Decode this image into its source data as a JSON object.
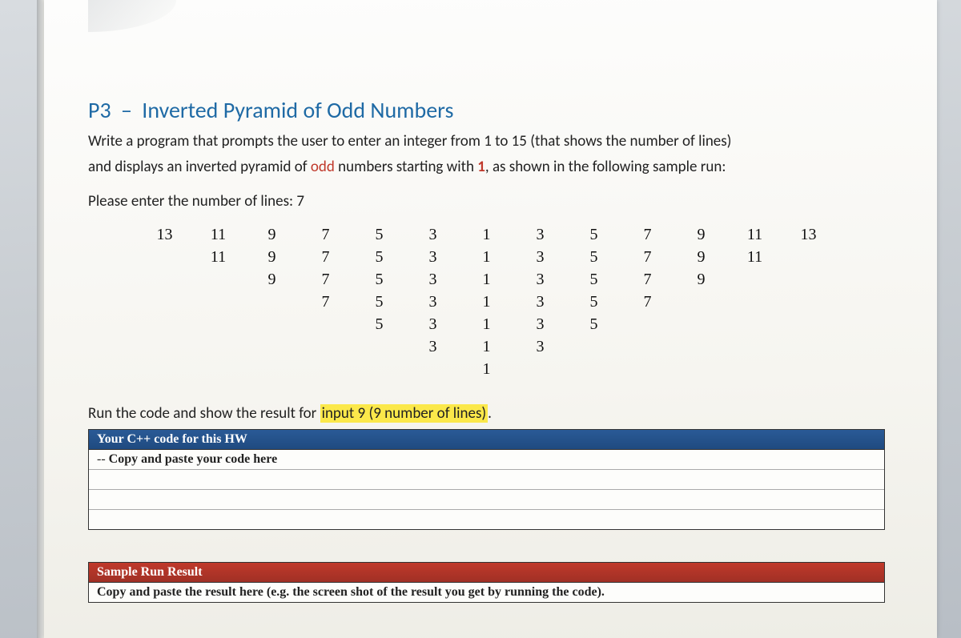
{
  "heading": {
    "prefix": "P3",
    "dash": "–",
    "title": "Inverted Pyramid of Odd Numbers"
  },
  "description": {
    "line1_a": "Write a program that prompts the user to enter an integer from 1 to 15 (that shows the number of lines)",
    "line2_a": "and displays an inverted pyramid of ",
    "line2_odd": "odd",
    "line2_b": " numbers starting with ",
    "line2_one": "1",
    "line2_c": ", as shown in the following sample run:"
  },
  "prompt": "Please enter the number of lines: 7",
  "pyramid": [
    [
      "13",
      "11",
      "9",
      "7",
      "5",
      "3",
      "1",
      "3",
      "5",
      "7",
      "9",
      "11",
      "13"
    ],
    [
      "",
      "11",
      "9",
      "7",
      "5",
      "3",
      "1",
      "3",
      "5",
      "7",
      "9",
      "11",
      ""
    ],
    [
      "",
      "",
      "9",
      "7",
      "5",
      "3",
      "1",
      "3",
      "5",
      "7",
      "9",
      "",
      ""
    ],
    [
      "",
      "",
      "",
      "7",
      "5",
      "3",
      "1",
      "3",
      "5",
      "7",
      "",
      "",
      ""
    ],
    [
      "",
      "",
      "",
      "",
      "5",
      "3",
      "1",
      "3",
      "5",
      "",
      "",
      "",
      ""
    ],
    [
      "",
      "",
      "",
      "",
      "",
      "3",
      "1",
      "3",
      "",
      "",
      "",
      "",
      ""
    ],
    [
      "",
      "",
      "",
      "",
      "",
      "",
      "1",
      "",
      "",
      "",
      "",
      "",
      ""
    ]
  ],
  "run_text": {
    "a": "Run the code and show the result for ",
    "hl": "input 9 (9 number of lines)",
    "b": "."
  },
  "code_band": {
    "header": "Your C++ code for this HW",
    "row1_prefix": "--",
    "row1": "Copy and paste your code here"
  },
  "result_band": {
    "header": "Sample Run Result",
    "row1": "Copy and paste the result here (e.g. the screen shot of the result you get by running the code)."
  }
}
